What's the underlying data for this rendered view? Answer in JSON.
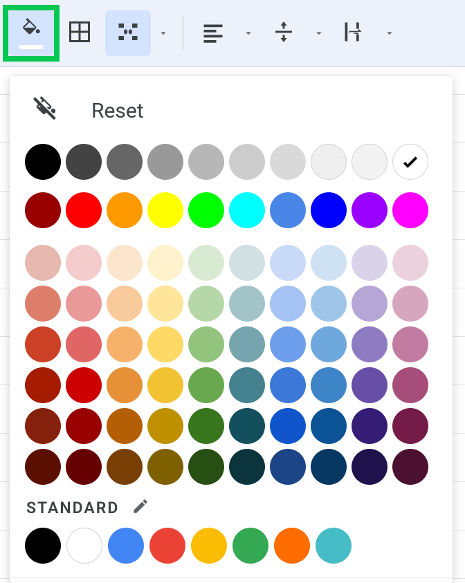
{
  "toolbar": {
    "fill_color_icon": "fill-color",
    "fill_underline_color": "#ffffff",
    "borders_icon": "borders",
    "merge_icon": "merge-cells",
    "halign_icon": "align-left",
    "valign_icon": "vertical-align-middle",
    "wrap_icon": "text-wrap"
  },
  "popup": {
    "reset_label": "Reset",
    "standard_label": "STANDARD",
    "selected_color": "#ffffff",
    "grays": [
      "#000000",
      "#434343",
      "#666666",
      "#999999",
      "#b7b7b7",
      "#cccccc",
      "#d9d9d9",
      "#efefef",
      "#f3f3f3",
      "#ffffff"
    ],
    "brights": [
      "#980000",
      "#ff0000",
      "#ff9900",
      "#ffff00",
      "#00ff00",
      "#00ffff",
      "#4a86e8",
      "#0000ff",
      "#9900ff",
      "#ff00ff"
    ],
    "shades": [
      [
        "#e6b8af",
        "#f4cccc",
        "#fce5cd",
        "#fff2cc",
        "#d9ead3",
        "#d0e0e3",
        "#c9daf8",
        "#cfe2f3",
        "#d9d2e9",
        "#ead1dc"
      ],
      [
        "#dd7e6b",
        "#ea9999",
        "#f9cb9c",
        "#ffe599",
        "#b6d7a8",
        "#a2c4c9",
        "#a4c2f4",
        "#9fc5e8",
        "#b4a7d6",
        "#d5a6bd"
      ],
      [
        "#cc4125",
        "#e06666",
        "#f6b26b",
        "#ffd966",
        "#93c47d",
        "#76a5af",
        "#6d9eeb",
        "#6fa8dc",
        "#8e7cc3",
        "#c27ba0"
      ],
      [
        "#a61c00",
        "#cc0000",
        "#e69138",
        "#f1c232",
        "#6aa84f",
        "#45818e",
        "#3c78d8",
        "#3d85c6",
        "#674ea7",
        "#a64d79"
      ],
      [
        "#85200c",
        "#990000",
        "#b45f06",
        "#bf9000",
        "#38761d",
        "#134f5c",
        "#1155cc",
        "#0b5394",
        "#351c75",
        "#741b47"
      ],
      [
        "#5b0f00",
        "#660000",
        "#783f04",
        "#7f6000",
        "#274e13",
        "#0c343d",
        "#1c4587",
        "#073763",
        "#20124d",
        "#4c1130"
      ]
    ],
    "standard": [
      "#000000",
      "#ffffff",
      "#4285f4",
      "#ea4335",
      "#fbbc04",
      "#34a853",
      "#ff6d01",
      "#46bdc6"
    ]
  }
}
